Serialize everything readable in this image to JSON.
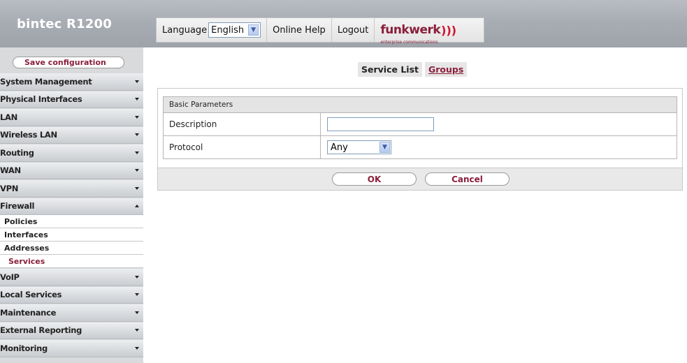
{
  "header": {
    "product": "bintec R1200",
    "language_label": "Language",
    "language_value": "English",
    "online_help": "Online Help",
    "logout": "Logout",
    "logo_name": "funkwerk",
    "logo_tagline": "enterprise communications"
  },
  "sidebar": {
    "save": "Save configuration",
    "items": [
      {
        "label": "System Management"
      },
      {
        "label": "Physical Interfaces"
      },
      {
        "label": "LAN"
      },
      {
        "label": "Wireless LAN"
      },
      {
        "label": "Routing"
      },
      {
        "label": "WAN"
      },
      {
        "label": "VPN"
      },
      {
        "label": "Firewall"
      }
    ],
    "firewall_sub": [
      "Policies",
      "Interfaces",
      "Addresses",
      "Services"
    ],
    "items_after": [
      {
        "label": "VoIP"
      },
      {
        "label": "Local Services"
      },
      {
        "label": "Maintenance"
      },
      {
        "label": "External Reporting"
      },
      {
        "label": "Monitoring"
      }
    ]
  },
  "tabs": {
    "service_list": "Service List",
    "groups": "Groups"
  },
  "form": {
    "section_title": "Basic Parameters",
    "description_label": "Description",
    "description_value": "",
    "protocol_label": "Protocol",
    "protocol_value": "Any"
  },
  "buttons": {
    "ok": "OK",
    "cancel": "Cancel"
  },
  "colors": {
    "accent": "#8a1f3b",
    "header_bg": "#a8adb4"
  }
}
